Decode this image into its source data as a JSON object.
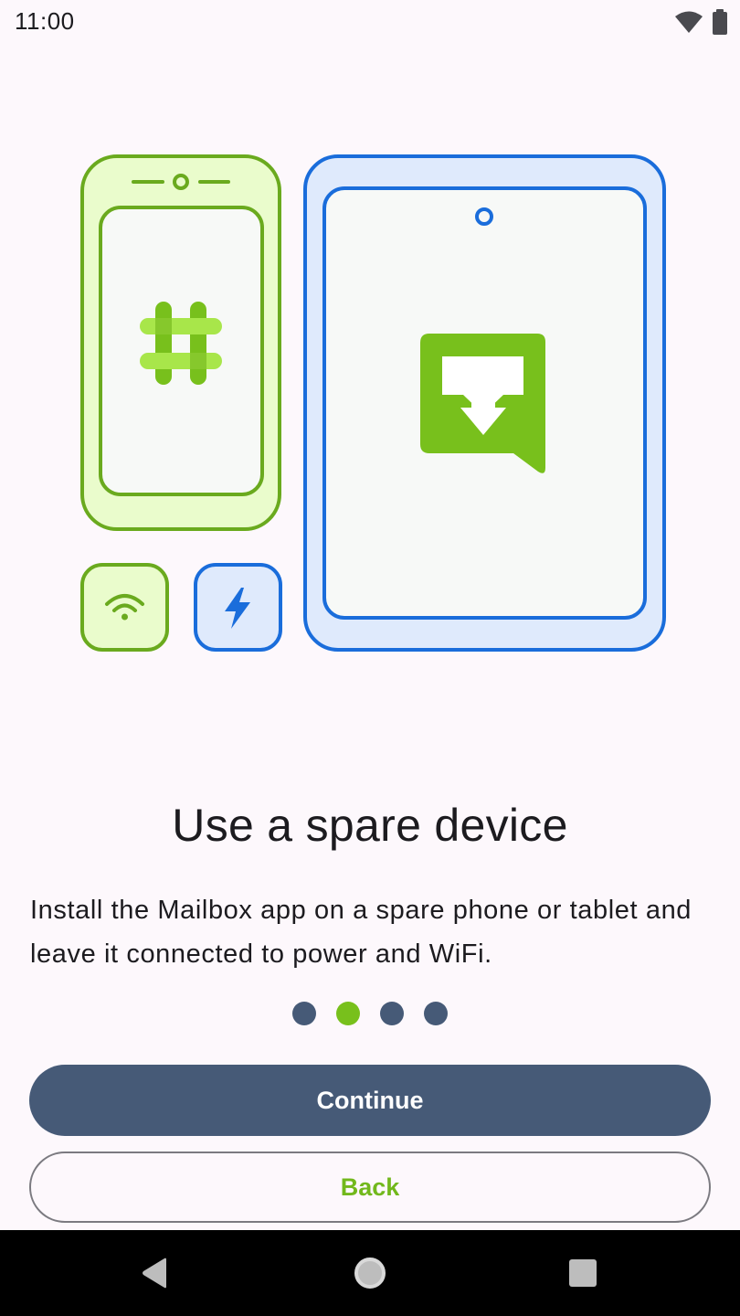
{
  "status_bar": {
    "time": "11:00",
    "icons": [
      "wifi-icon",
      "battery-icon"
    ]
  },
  "illustration": {
    "phone_icon": "hashtag-icon",
    "tablet_icon": "mailbox-download-icon",
    "tiles": [
      "wifi-icon",
      "lightning-icon"
    ],
    "colors": {
      "green": "#6aaa1e",
      "green_fill": "#eafccc",
      "blue": "#1a6ddb",
      "blue_fill": "#dfeafc",
      "screen": "#f7f9f7"
    }
  },
  "content": {
    "title": "Use a spare device",
    "description": "Install the Mailbox app on a spare phone or tablet and leave it connected to power and WiFi."
  },
  "pager": {
    "total": 4,
    "active_index": 1,
    "active_color": "#78c01c",
    "inactive_color": "#465a77"
  },
  "buttons": {
    "continue_label": "Continue",
    "back_label": "Back"
  },
  "nav_bar": {
    "items": [
      "back-triangle-icon",
      "home-circle-icon",
      "recents-square-icon"
    ]
  }
}
